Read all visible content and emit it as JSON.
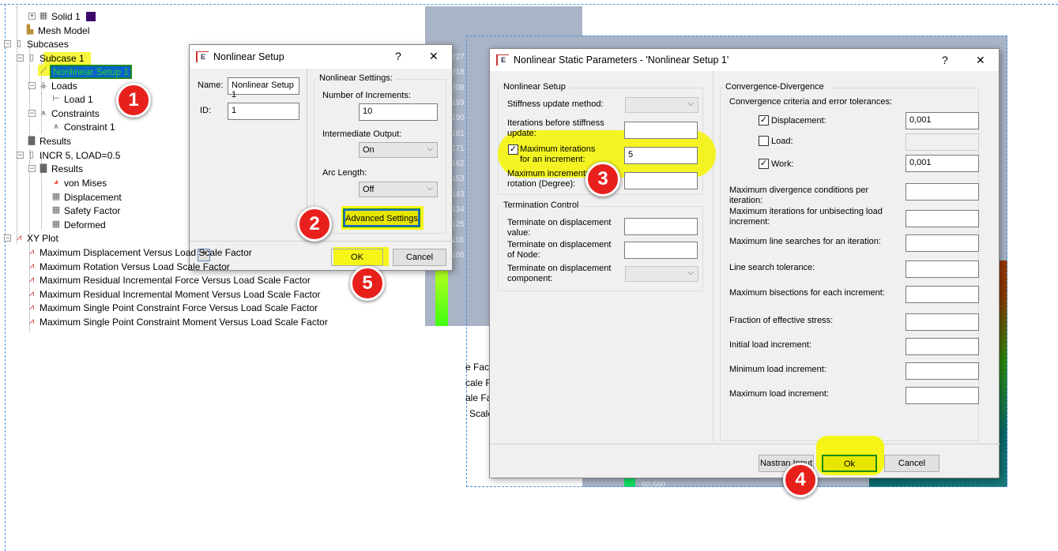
{
  "tree": {
    "items": [
      {
        "label": "Solid 1",
        "icon": "solid-icon"
      },
      {
        "label": "Mesh Model",
        "icon": "mesh-icon"
      },
      {
        "label": "Subcases",
        "icon": "subcases-icon"
      },
      {
        "label": "Subcase 1",
        "icon": "subcase-icon"
      },
      {
        "label": "Nonlinear Setup 1",
        "icon": "nonlinear-icon"
      },
      {
        "label": "Loads",
        "icon": "loads-icon"
      },
      {
        "label": "Load 1",
        "icon": "load-icon"
      },
      {
        "label": "Constraints",
        "icon": "constraints-icon"
      },
      {
        "label": "Constraint 1",
        "icon": "constraint-icon"
      },
      {
        "label": "Results",
        "icon": "results-icon"
      },
      {
        "label": "INCR 5, LOAD=0.5",
        "icon": "subcase-icon"
      },
      {
        "label": "Results",
        "icon": "results-icon"
      },
      {
        "label": "von Mises",
        "icon": "contour-icon"
      },
      {
        "label": "Displacement",
        "icon": "mesh-result-icon"
      },
      {
        "label": "Safety Factor",
        "icon": "mesh-result-icon"
      },
      {
        "label": "Deformed",
        "icon": "mesh-result-icon"
      },
      {
        "label": "XY Plot",
        "icon": "xyplot-icon"
      },
      {
        "label": "Maximum Displacement Versus Load Scale Factor",
        "icon": "xyplot-icon"
      },
      {
        "label": "Maximum Rotation Versus Load Scale Factor",
        "icon": "xyplot-icon"
      },
      {
        "label": "Maximum Residual Incremental Force Versus Load Scale Factor",
        "icon": "xyplot-icon"
      },
      {
        "label": "Maximum Residual Incremental Moment Versus Load Scale Factor",
        "icon": "xyplot-icon"
      },
      {
        "label": "Maximum Single Point Constraint Force Versus Load Scale Factor",
        "icon": "xyplot-icon"
      },
      {
        "label": "Maximum Single Point Constraint Moment Versus Load Scale Factor",
        "icon": "xyplot-icon"
      }
    ]
  },
  "viewport": {
    "legend_values": [
      "227",
      "218",
      "208",
      "199",
      "190",
      "181",
      "171",
      "162",
      "153",
      "143",
      "134",
      "125",
      "116",
      "106"
    ],
    "bottom_value": "60.680",
    "partial_text": [
      "e Fact",
      "cale F",
      "ale Fa",
      "Scale"
    ]
  },
  "dialog1": {
    "title": "Nonlinear Setup",
    "help": "?",
    "close": "✕",
    "name_label": "Name:",
    "name_value": "Nonlinear Setup 1",
    "id_label": "ID:",
    "id_value": "1",
    "group_title": "Nonlinear Settings:",
    "increments_label": "Number of Increments:",
    "increments_value": "10",
    "output_label": "Intermediate Output:",
    "output_value": "On",
    "arc_label": "Arc Length:",
    "arc_value": "Off",
    "advanced_button": "Advanced Settings",
    "collapse": "⌃",
    "ok": "OK",
    "cancel": "Cancel"
  },
  "dialog2": {
    "title": "Nonlinear Static Parameters - 'Nonlinear Setup 1'",
    "help": "?",
    "close": "✕",
    "setup_group": "Nonlinear Setup",
    "stiffness_label": "Stiffness update method:",
    "stiffness_value": "",
    "iter_before_label": "Iterations before stiffness update:",
    "iter_before_value": "",
    "max_iter_label": "Maximum iterations for an increment:",
    "max_iter_checked": true,
    "max_iter_value": "5",
    "max_rot_label": "Maximum incremental rotation (Degree):",
    "max_rot_value": "",
    "term_group": "Termination Control",
    "term_disp_value_label": "Terminate on displacement value:",
    "term_disp_node_label": "Terminate on displacement of Node:",
    "term_disp_comp_label": "Terminate on displacement component:",
    "conv_group": "Convergence-Divergence",
    "conv_criteria_label": "Convergence criteria and error tolerances:",
    "displacement_label": "Displacement:",
    "displacement_checked": true,
    "displacement_value": "0,001",
    "load_label": "Load:",
    "load_checked": false,
    "load_value": "",
    "work_label": "Work:",
    "work_checked": true,
    "work_value": "0,001",
    "fields": [
      {
        "label": "Maximum divergence conditions per iteration:",
        "value": ""
      },
      {
        "label": "Maximum iterations for unbisecting load increment:",
        "value": ""
      },
      {
        "label": "Maximum line searches for an iteration:",
        "value": ""
      },
      {
        "label": "Line search tolerance:",
        "value": ""
      },
      {
        "label": "Maximum bisections for each increment:",
        "value": ""
      },
      {
        "label": "Fraction of effective stress:",
        "value": ""
      },
      {
        "label": "Initial load increment:",
        "value": ""
      },
      {
        "label": "Minimum load increment:",
        "value": ""
      },
      {
        "label": "Maximum load increment:",
        "value": ""
      }
    ],
    "nastran_button": "Nastran Input",
    "ok": "Ok",
    "cancel": "Cancel"
  },
  "annotations": [
    "1",
    "2",
    "3",
    "4",
    "5"
  ],
  "colors": {
    "highlight": "#f3f300",
    "badge": "#e8201c",
    "selection": "#0a63c9"
  }
}
